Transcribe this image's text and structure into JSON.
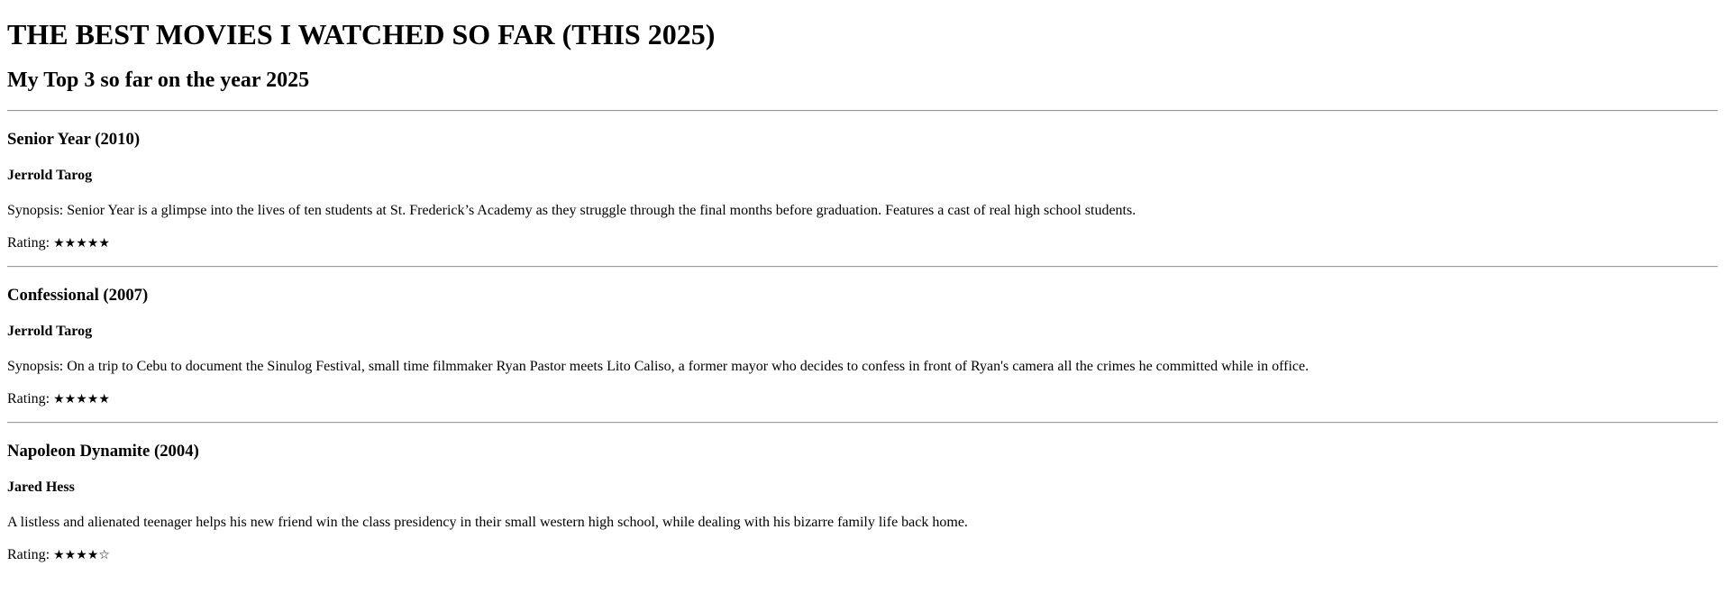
{
  "page": {
    "title": "THE BEST MOVIES I WATCHED SO FAR (THIS 2025)",
    "subtitle": "My Top 3 so far on the year 2025"
  },
  "movies": [
    {
      "title": "Senior Year (2010)",
      "director": "Jerrold Tarog",
      "synopsis": "Synopsis: Senior Year is a glimpse into the lives of ten students at St. Frederick’s Academy as they struggle through the final months before graduation. Features a cast of real high school students.",
      "rating_label": "Rating:",
      "rating_stars": "★★★★★",
      "rating_value": 5,
      "rating_max": 5
    },
    {
      "title": "Confessional (2007)",
      "director": "Jerrold Tarog",
      "synopsis": "Synopsis: On a trip to Cebu to document the Sinulog Festival, small time filmmaker Ryan Pastor meets Lito Caliso, a former mayor who decides to confess in front of Ryan's camera all the crimes he committed while in office.",
      "rating_label": "Rating:",
      "rating_stars": "★★★★★",
      "rating_value": 5,
      "rating_max": 5
    },
    {
      "title": "Napoleon Dynamite (2004)",
      "director": "Jared Hess",
      "synopsis": "A listless and alienated teenager helps his new friend win the class presidency in their small western high school, while dealing with his bizarre family life back home.",
      "rating_label": "Rating:",
      "rating_stars": "★★★★☆",
      "rating_value": 4,
      "rating_max": 5
    }
  ]
}
